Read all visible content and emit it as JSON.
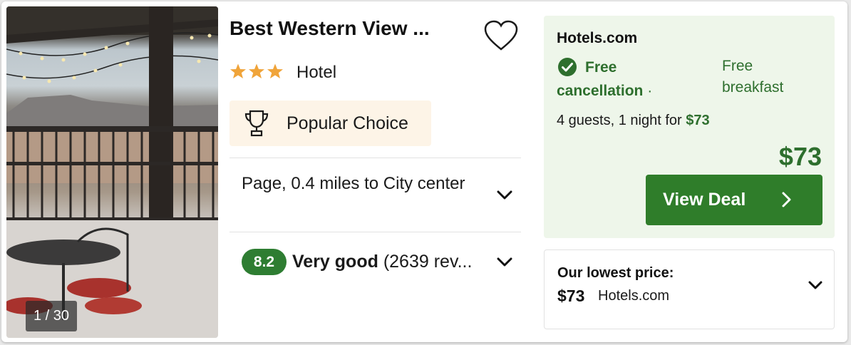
{
  "photo": {
    "counter": "1 / 30"
  },
  "hotel": {
    "name": "Best Western View ...",
    "stars": 3,
    "type": "Hotel",
    "badge": "Popular Choice",
    "location": "Page, 0.4 miles to City center",
    "rating": {
      "score": "8.2",
      "label": "Very good",
      "reviews": "(2639 rev..."
    }
  },
  "deal": {
    "provider": "Hotels.com",
    "free_cancellation": "Free cancellation",
    "separator": "·",
    "free_breakfast": "Free breakfast",
    "guests_text": "4 guests, 1 night for",
    "guests_price": "$73",
    "price": "$73",
    "cta": "View Deal"
  },
  "lowest": {
    "title": "Our lowest price:",
    "price": "$73",
    "provider": "Hotels.com"
  },
  "colors": {
    "accent_green": "#2e7d32",
    "deal_bg": "#eef6ea",
    "badge_bg": "#fdf4e7",
    "star": "#f0a43a"
  },
  "icons": [
    "heart-icon",
    "star-icon",
    "trophy-icon",
    "chevron-down-icon",
    "check-circle-icon",
    "chevron-right-icon"
  ]
}
